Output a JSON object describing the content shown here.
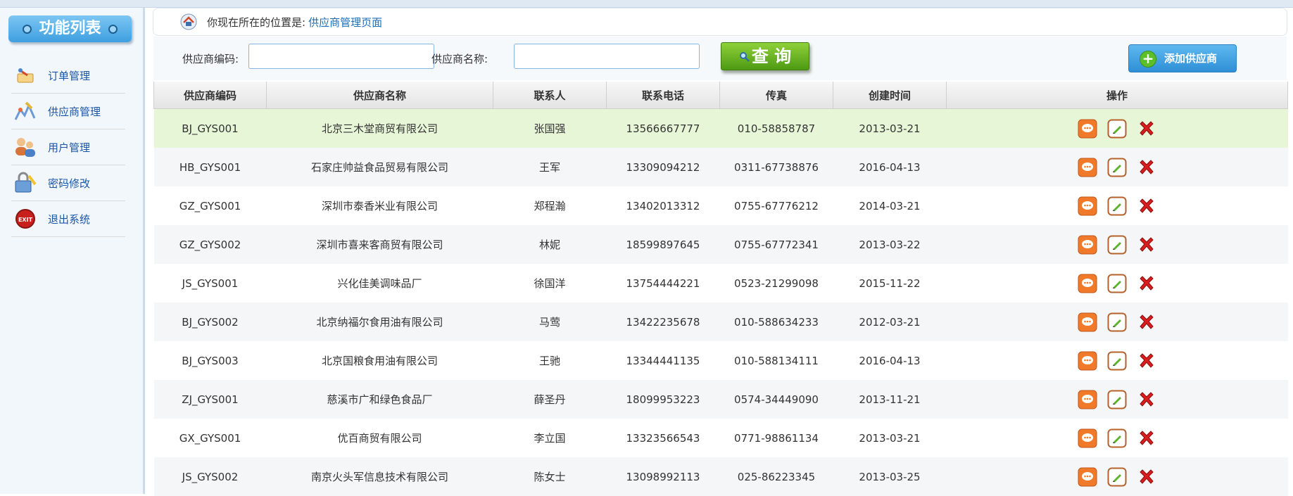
{
  "sidebar": {
    "title": "功能列表",
    "items": [
      {
        "label": "订单管理",
        "icon": "order-icon"
      },
      {
        "label": "供应商管理",
        "icon": "supplier-icon"
      },
      {
        "label": "用户管理",
        "icon": "users-icon"
      },
      {
        "label": "密码修改",
        "icon": "password-icon"
      },
      {
        "label": "退出系统",
        "icon": "exit-icon"
      }
    ]
  },
  "breadcrumb": {
    "prefix": "你现在所在的位置是:",
    "current": "供应商管理页面"
  },
  "search": {
    "code_label": "供应商编码:",
    "code_value": "",
    "name_label": "供应商名称:",
    "name_value": "",
    "query_label": "查 询",
    "add_label": "添加供应商"
  },
  "table": {
    "headers": [
      "供应商编码",
      "供应商名称",
      "联系人",
      "联系电话",
      "传真",
      "创建时间",
      "操作"
    ],
    "rows": [
      {
        "code": "BJ_GYS001",
        "name": "北京三木堂商贸有限公司",
        "contact": "张国强",
        "phone": "13566667777",
        "fax": "010-58858787",
        "created": "2013-03-21"
      },
      {
        "code": "HB_GYS001",
        "name": "石家庄帅益食品贸易有限公司",
        "contact": "王军",
        "phone": "13309094212",
        "fax": "0311-67738876",
        "created": "2016-04-13"
      },
      {
        "code": "GZ_GYS001",
        "name": "深圳市泰香米业有限公司",
        "contact": "郑程瀚",
        "phone": "13402013312",
        "fax": "0755-67776212",
        "created": "2014-03-21"
      },
      {
        "code": "GZ_GYS002",
        "name": "深圳市喜来客商贸有限公司",
        "contact": "林妮",
        "phone": "18599897645",
        "fax": "0755-67772341",
        "created": "2013-03-22"
      },
      {
        "code": "JS_GYS001",
        "name": "兴化佳美调味品厂",
        "contact": "徐国洋",
        "phone": "13754444221",
        "fax": "0523-21299098",
        "created": "2015-11-22"
      },
      {
        "code": "BJ_GYS002",
        "name": "北京纳福尔食用油有限公司",
        "contact": "马莺",
        "phone": "13422235678",
        "fax": "010-588634233",
        "created": "2012-03-21"
      },
      {
        "code": "BJ_GYS003",
        "name": "北京国粮食用油有限公司",
        "contact": "王驰",
        "phone": "13344441135",
        "fax": "010-588134111",
        "created": "2016-04-13"
      },
      {
        "code": "ZJ_GYS001",
        "name": "慈溪市广和绿色食品厂",
        "contact": "薛圣丹",
        "phone": "18099953223",
        "fax": "0574-34449090",
        "created": "2013-11-21"
      },
      {
        "code": "GX_GYS001",
        "name": "优百商贸有限公司",
        "contact": "李立国",
        "phone": "13323566543",
        "fax": "0771-98861134",
        "created": "2013-03-21"
      },
      {
        "code": "JS_GYS002",
        "name": "南京火头军信息技术有限公司",
        "contact": "陈女士",
        "phone": "13098992113",
        "fax": "025-86223345",
        "created": "2013-03-25"
      }
    ]
  },
  "colors": {
    "accent": "#3f9fe0",
    "query_green": "#5fae1e",
    "highlight_row": "#e8f6d8",
    "link_blue": "#1a56a8"
  }
}
